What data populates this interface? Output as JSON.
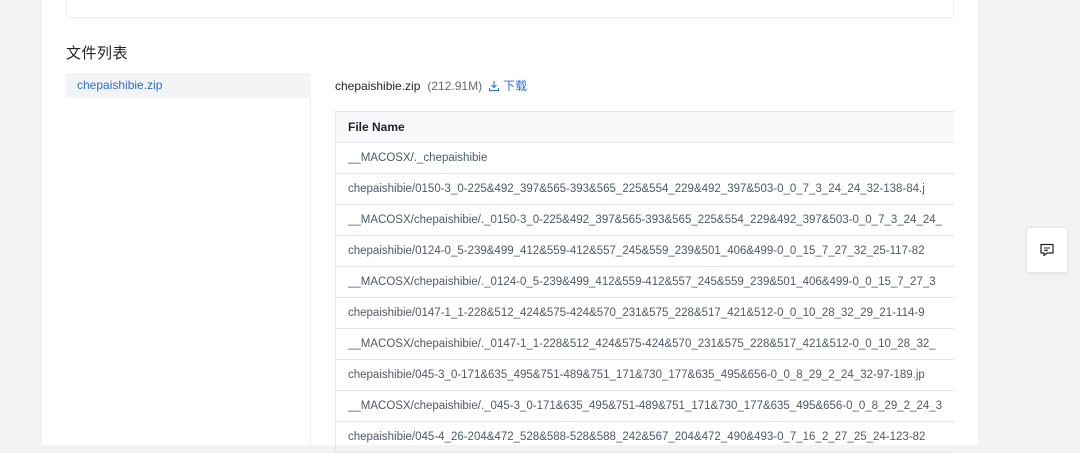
{
  "section": {
    "title": "文件列表"
  },
  "sidebar": {
    "files": [
      {
        "label": "chepaishibie.zip"
      }
    ]
  },
  "archive": {
    "name": "chepaishibie.zip",
    "size": "(212.91M)",
    "download_label": "下载",
    "download_icon": "download-icon"
  },
  "table": {
    "header": "File Name",
    "rows": [
      "__MACOSX/._chepaishibie",
      "chepaishibie/0150-3_0-225&492_397&565-393&565_225&554_229&492_397&503-0_0_7_3_24_24_32-138-84.j",
      "__MACOSX/chepaishibie/._0150-3_0-225&492_397&565-393&565_225&554_229&492_397&503-0_0_7_3_24_24_",
      "chepaishibie/0124-0_5-239&499_412&559-412&557_245&559_239&501_406&499-0_0_15_7_27_32_25-117-82",
      "__MACOSX/chepaishibie/._0124-0_5-239&499_412&559-412&557_245&559_239&501_406&499-0_0_15_7_27_3",
      "chepaishibie/0147-1_1-228&512_424&575-424&570_231&575_228&517_421&512-0_0_10_28_32_29_21-114-9",
      "__MACOSX/chepaishibie/._0147-1_1-228&512_424&575-424&570_231&575_228&517_421&512-0_0_10_28_32_",
      "chepaishibie/045-3_0-171&635_495&751-489&751_171&730_177&635_495&656-0_0_8_29_2_24_32-97-189.jp",
      "__MACOSX/chepaishibie/._045-3_0-171&635_495&751-489&751_171&730_177&635_495&656-0_0_8_29_2_24_3",
      "chepaishibie/045-4_26-204&472_528&588-528&588_242&567_204&472_490&493-0_7_16_2_27_25_24-123-82"
    ]
  },
  "feedback": {
    "icon": "message-icon"
  },
  "colors": {
    "accent": "#2b6fd6",
    "background": "#f2f3f5",
    "border": "#e4e6ea"
  }
}
